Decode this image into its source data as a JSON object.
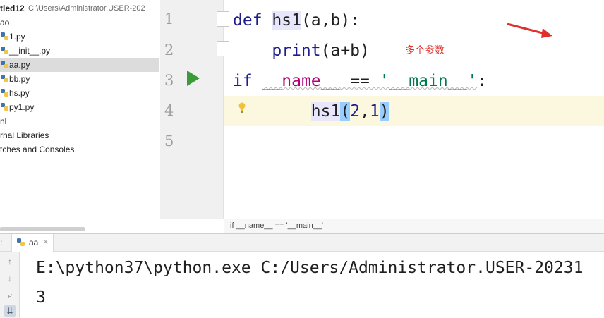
{
  "project_tree": {
    "root_name": "tled12",
    "root_path": "C:\\Users\\Administrator.USER-202",
    "items": [
      {
        "label": "ao",
        "selected": false
      },
      {
        "label": "1.py",
        "selected": false
      },
      {
        "label": "__init__.py",
        "selected": false
      },
      {
        "label": "aa.py",
        "selected": true
      },
      {
        "label": "bb.py",
        "selected": false
      },
      {
        "label": "hs.py",
        "selected": false
      },
      {
        "label": "py1.py",
        "selected": false
      },
      {
        "label": "nl",
        "selected": false
      },
      {
        "label": "rnal Libraries",
        "selected": false
      },
      {
        "label": "tches and Consoles",
        "selected": false
      }
    ]
  },
  "editor": {
    "line_numbers": [
      "1",
      "2",
      "3",
      "4",
      "5"
    ],
    "lines": {
      "l1_kw": "def",
      "l1_name": "hs1",
      "l1_rest": "(a,b):",
      "l2_indent": "    ",
      "l2_builtin": "print",
      "l2_rest": "(a+b)",
      "l3_kw": "if",
      "l3_dunder": "__name__",
      "l3_eq": " == ",
      "l3_str": "'__main__'",
      "l3_colon": ":",
      "l4_indent": "        ",
      "l4_call": "hs1",
      "l4_open": "(",
      "l4_a": "2",
      "l4_comma": ",",
      "l4_b": "1",
      "l4_close": ")"
    },
    "breadcrumb": "if __name__ == '__main__'"
  },
  "annotation": {
    "note": "多个参数",
    "color": "#e0302c"
  },
  "run_panel": {
    "edge_label": ":",
    "tab_label": "aa",
    "tab_close": "×",
    "toolbar_icons": [
      "arrow-up-icon",
      "arrow-down-icon",
      "soft-wrap-icon",
      "scroll-to-end-icon"
    ],
    "console_lines": [
      "E:\\python37\\python.exe C:/Users/Administrator.USER-20231",
      "3"
    ]
  },
  "colors": {
    "keyword": "#1d1d8c",
    "dunder": "#b2007a",
    "string": "#007a4c",
    "run_arrow": "#3b9b3b",
    "current_line": "#fcf8df",
    "paren_match": "#99ccff"
  }
}
